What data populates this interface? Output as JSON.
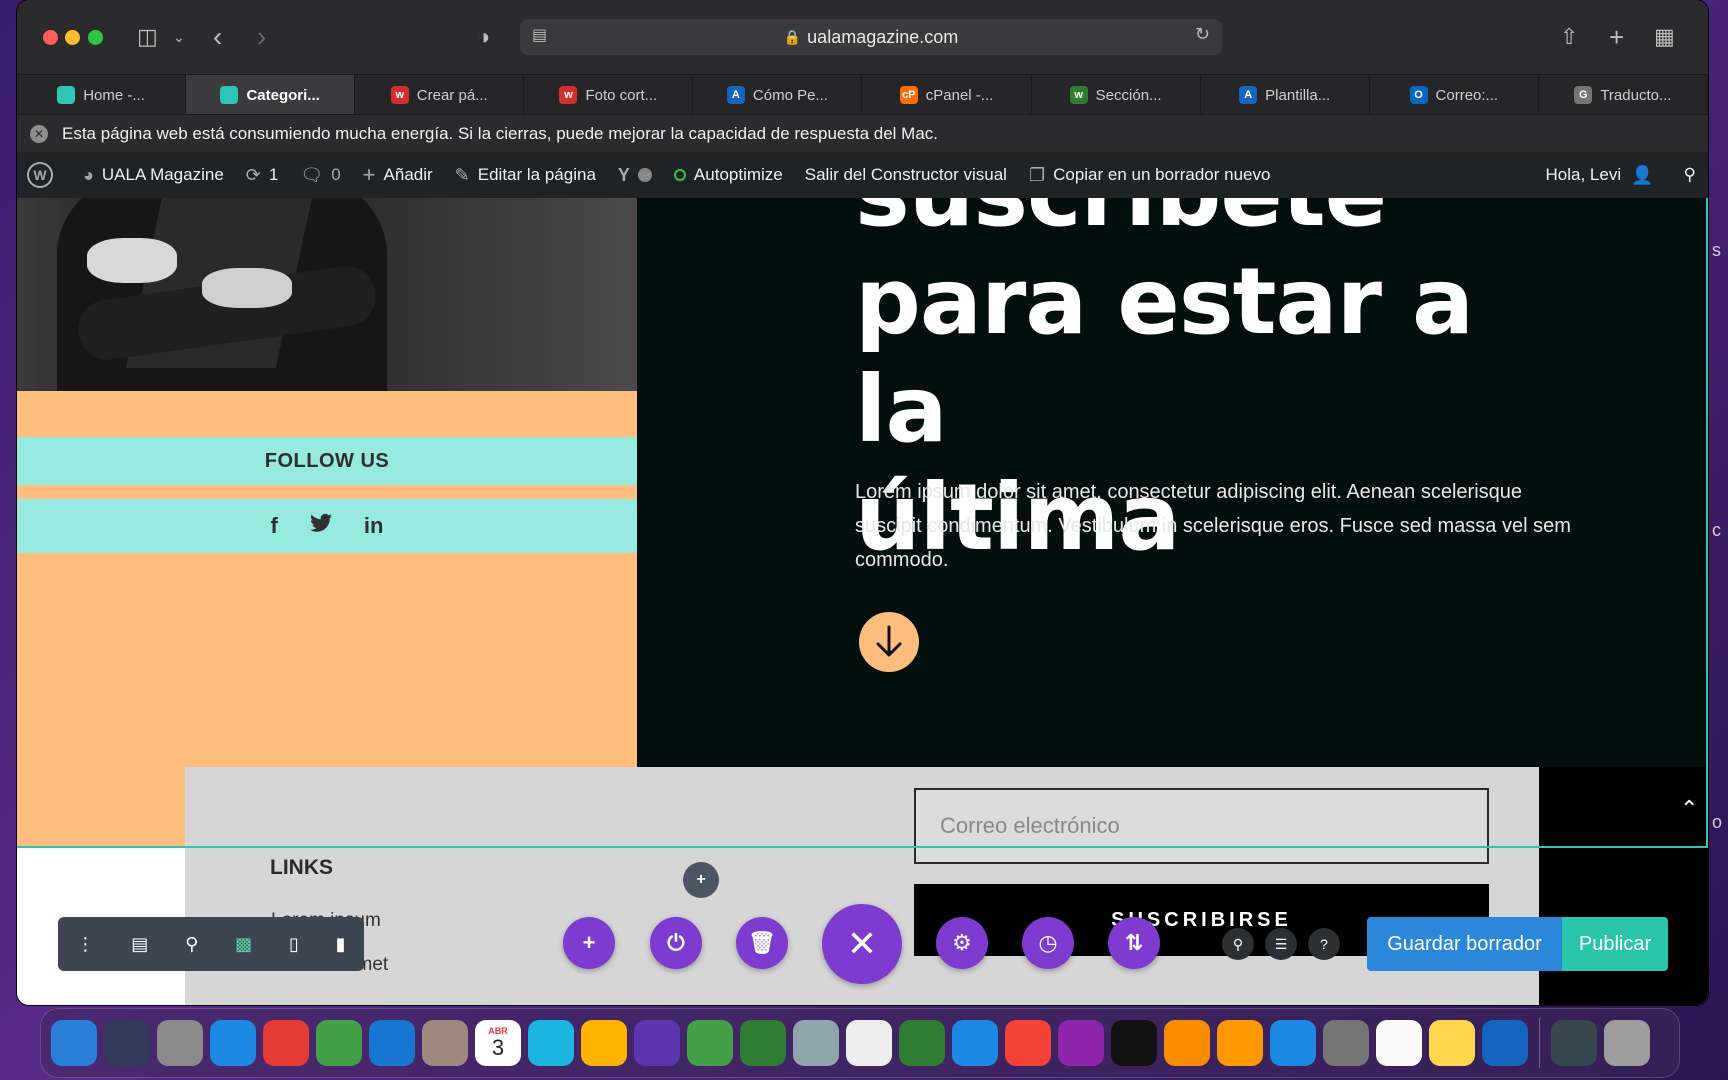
{
  "browser": {
    "url": "ualamagazine.com",
    "tabs": [
      {
        "label": "Home -...",
        "color": "#2ec4b6",
        "glyph": ""
      },
      {
        "label": "Categori...",
        "color": "#2ec4b6",
        "glyph": "",
        "active": true
      },
      {
        "label": "Crear pá...",
        "color": "#d32f2f",
        "glyph": "w"
      },
      {
        "label": "Foto cort...",
        "color": "#d32f2f",
        "glyph": "w"
      },
      {
        "label": "Cómo Pe...",
        "color": "#1565c0",
        "glyph": "A"
      },
      {
        "label": "cPanel -...",
        "color": "#ff6d00",
        "glyph": "cP"
      },
      {
        "label": "Sección...",
        "color": "#2e7d32",
        "glyph": "w"
      },
      {
        "label": "Plantilla...",
        "color": "#1565c0",
        "glyph": "A"
      },
      {
        "label": "Correo:...",
        "color": "#0a66c2",
        "glyph": "O"
      },
      {
        "label": "Traducto...",
        "color": "#757575",
        "glyph": "G"
      }
    ],
    "energy_notice": "Esta página web está consumiendo mucha energía. Si la cierras, puede mejorar la capacidad de respuesta del Mac."
  },
  "adminbar": {
    "site": "UALA Magazine",
    "updates": "1",
    "comments": "0",
    "add": "Añadir",
    "edit": "Editar la página",
    "autoptimize": "Autoptimize",
    "exit_builder": "Salir del Constructor visual",
    "copy_draft": "Copiar en un borrador nuevo",
    "greeting": "Hola, Levi"
  },
  "page": {
    "hero_title_top": "suscríbete",
    "hero_title_lines": [
      "para estar a la",
      "última"
    ],
    "hero_text": "Lorem ipsum dolor sit amet, consectetur adipiscing elit. Aenean scelerisque suscipit condimentum. Vestibulum in scelerisque eros. Fusce sed massa vel sem commodo.",
    "follow_us": "FOLLOW US",
    "social": [
      "f",
      "t",
      "in"
    ],
    "email_placeholder": "Correo electrónico",
    "subscribe": "SUSCRIBIRSE",
    "links_title": "LINKS",
    "links": [
      "Lorem ipsum",
      "Dolor sit amet"
    ]
  },
  "builder": {
    "save_draft": "Guardar borrador",
    "publish": "Publicar"
  },
  "dock": {
    "calendar_month": "ABR",
    "calendar_day": "3",
    "apps": [
      {
        "name": "finder",
        "color": "#2a7fd8"
      },
      {
        "name": "siri",
        "color": "#333a5a"
      },
      {
        "name": "launchpad",
        "color": "#8a8a8a"
      },
      {
        "name": "safari",
        "color": "#1e88e5"
      },
      {
        "name": "youtube",
        "color": "#e53935"
      },
      {
        "name": "maps",
        "color": "#43a047"
      },
      {
        "name": "mail",
        "color": "#1976d2"
      },
      {
        "name": "contacts",
        "color": "#a1887f"
      },
      {
        "name": "calendar",
        "color": "#ffffff"
      },
      {
        "name": "canva",
        "color": "#1cb5e0"
      },
      {
        "name": "photos",
        "color": "#ffb300"
      },
      {
        "name": "imovie",
        "color": "#5e35b1"
      },
      {
        "name": "messages",
        "color": "#43a047"
      },
      {
        "name": "facetime",
        "color": "#2e7d32"
      },
      {
        "name": "preview",
        "color": "#90a4ae"
      },
      {
        "name": "textedit",
        "color": "#eeeeee"
      },
      {
        "name": "numbers",
        "color": "#2e7d32"
      },
      {
        "name": "keynote",
        "color": "#1e88e5"
      },
      {
        "name": "music",
        "color": "#f44336"
      },
      {
        "name": "podcasts",
        "color": "#8e24aa"
      },
      {
        "name": "appletv",
        "color": "#111111"
      },
      {
        "name": "pages",
        "color": "#fb8c00"
      },
      {
        "name": "books",
        "color": "#ff9800"
      },
      {
        "name": "appstore",
        "color": "#1e88e5"
      },
      {
        "name": "settings",
        "color": "#757575"
      },
      {
        "name": "reminders",
        "color": "#fafafa"
      },
      {
        "name": "notes",
        "color": "#ffd54f"
      },
      {
        "name": "word",
        "color": "#1565c0"
      },
      {
        "name": "quicktime",
        "color": "#37474f"
      },
      {
        "name": "trash",
        "color": "#9e9e9e"
      }
    ]
  }
}
